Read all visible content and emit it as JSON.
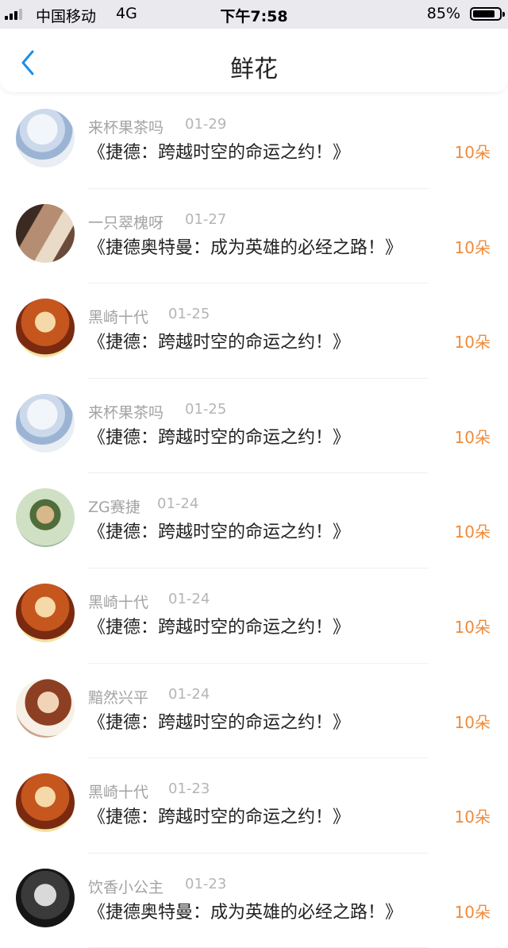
{
  "status_bar": {
    "carrier": "中国移动",
    "network": "4G",
    "time": "下午7:58",
    "battery_percent": "85%",
    "battery_level": 0.85,
    "signal_bars": 3
  },
  "nav": {
    "title": "鲜花",
    "back_icon": "chevron-left-icon",
    "accent_color": "#1a8fe6"
  },
  "colors": {
    "count": "#ef8b3b",
    "name": "#a3a3a3",
    "book": "#222222"
  },
  "items": [
    {
      "name": "来杯果茶吗",
      "date": "01-29",
      "book": "《捷德：跨越时空的命运之约！》",
      "count": "10朵"
    },
    {
      "name": "一只翠槐呀",
      "date": "01-27",
      "book": "《捷德奥特曼：成为英雄的必经之路！》",
      "count": "10朵"
    },
    {
      "name": "黑崎十代",
      "date": "01-25",
      "book": "《捷德：跨越时空的命运之约！》",
      "count": "10朵"
    },
    {
      "name": "来杯果茶吗",
      "date": "01-25",
      "book": "《捷德：跨越时空的命运之约！》",
      "count": "10朵"
    },
    {
      "name": "ZG赛捷",
      "date": "01-24",
      "book": "《捷德：跨越时空的命运之约！》",
      "count": "10朵"
    },
    {
      "name": "黑崎十代",
      "date": "01-24",
      "book": "《捷德：跨越时空的命运之约！》",
      "count": "10朵"
    },
    {
      "name": "黯然兴平",
      "date": "01-24",
      "book": "《捷德：跨越时空的命运之约！》",
      "count": "10朵"
    },
    {
      "name": "黑崎十代",
      "date": "01-23",
      "book": "《捷德：跨越时空的命运之约！》",
      "count": "10朵"
    },
    {
      "name": "饮香小公主",
      "date": "01-23",
      "book": "《捷德奥特曼：成为英雄的必经之路！》",
      "count": "10朵"
    }
  ]
}
